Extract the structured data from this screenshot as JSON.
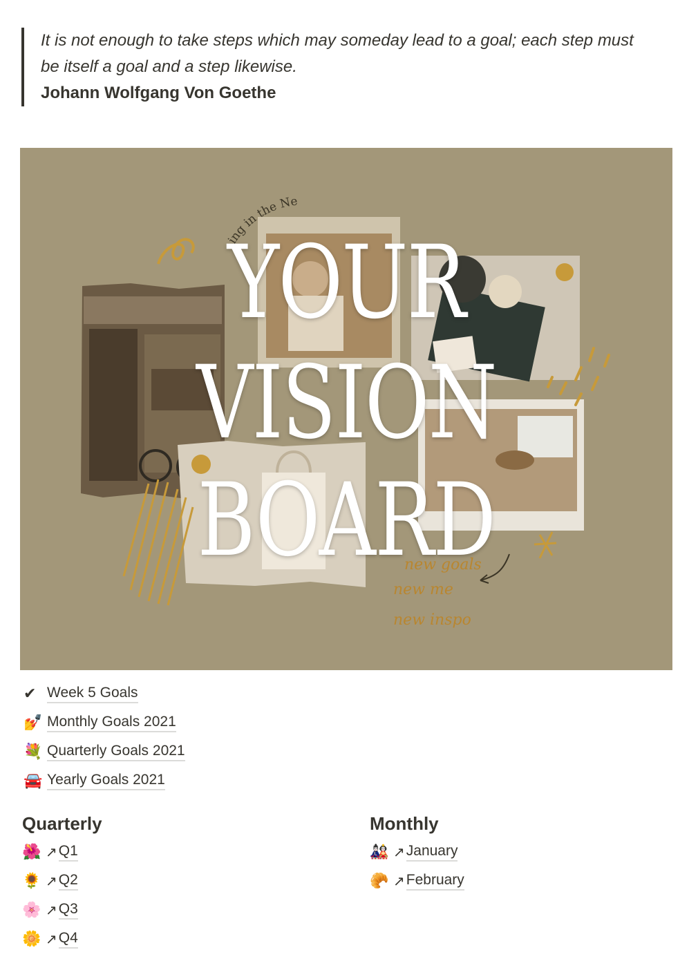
{
  "quote": {
    "text": "It is not enough to take steps which may someday lead to a goal; each step must be itself a goal and a step likewise.",
    "author": "Johann Wolfgang Von Goethe"
  },
  "vision_board": {
    "title_lines": [
      "YOUR",
      "VISION",
      "BOARD"
    ],
    "curve_text": "ing in the New Year",
    "script_lines": [
      "new goals",
      "new me",
      "new inspo"
    ],
    "background_color": "#a39779",
    "accent_color": "#c79a3a"
  },
  "goal_links": [
    {
      "icon": "check-icon",
      "emoji": "✔",
      "label": "Week 5 Goals"
    },
    {
      "icon": "nail-polish-icon",
      "emoji": "💅",
      "label": "Monthly Goals 2021"
    },
    {
      "icon": "bouquet-icon",
      "emoji": "💐",
      "label": "Quarterly Goals 2021"
    },
    {
      "icon": "car-icon",
      "emoji": "🚘",
      "label": "Yearly Goals 2021"
    }
  ],
  "quarterly": {
    "heading": "Quarterly",
    "items": [
      {
        "icon": "hibiscus-icon",
        "emoji": "🌺",
        "arrow": "↗",
        "label": "Q1"
      },
      {
        "icon": "sunflower-icon",
        "emoji": "🌻",
        "arrow": "↗",
        "label": "Q2"
      },
      {
        "icon": "cherry-blossom-icon",
        "emoji": "🌸",
        "arrow": "↗",
        "label": "Q3"
      },
      {
        "icon": "blossom-icon",
        "emoji": "🌼",
        "arrow": "↗",
        "label": "Q4"
      }
    ]
  },
  "monthly": {
    "heading": "Monthly",
    "items": [
      {
        "icon": "dolls-icon",
        "emoji": "🎎",
        "arrow": "↗",
        "label": "January"
      },
      {
        "icon": "croissant-icon",
        "emoji": "🥐",
        "arrow": "↗",
        "label": "February"
      }
    ]
  }
}
